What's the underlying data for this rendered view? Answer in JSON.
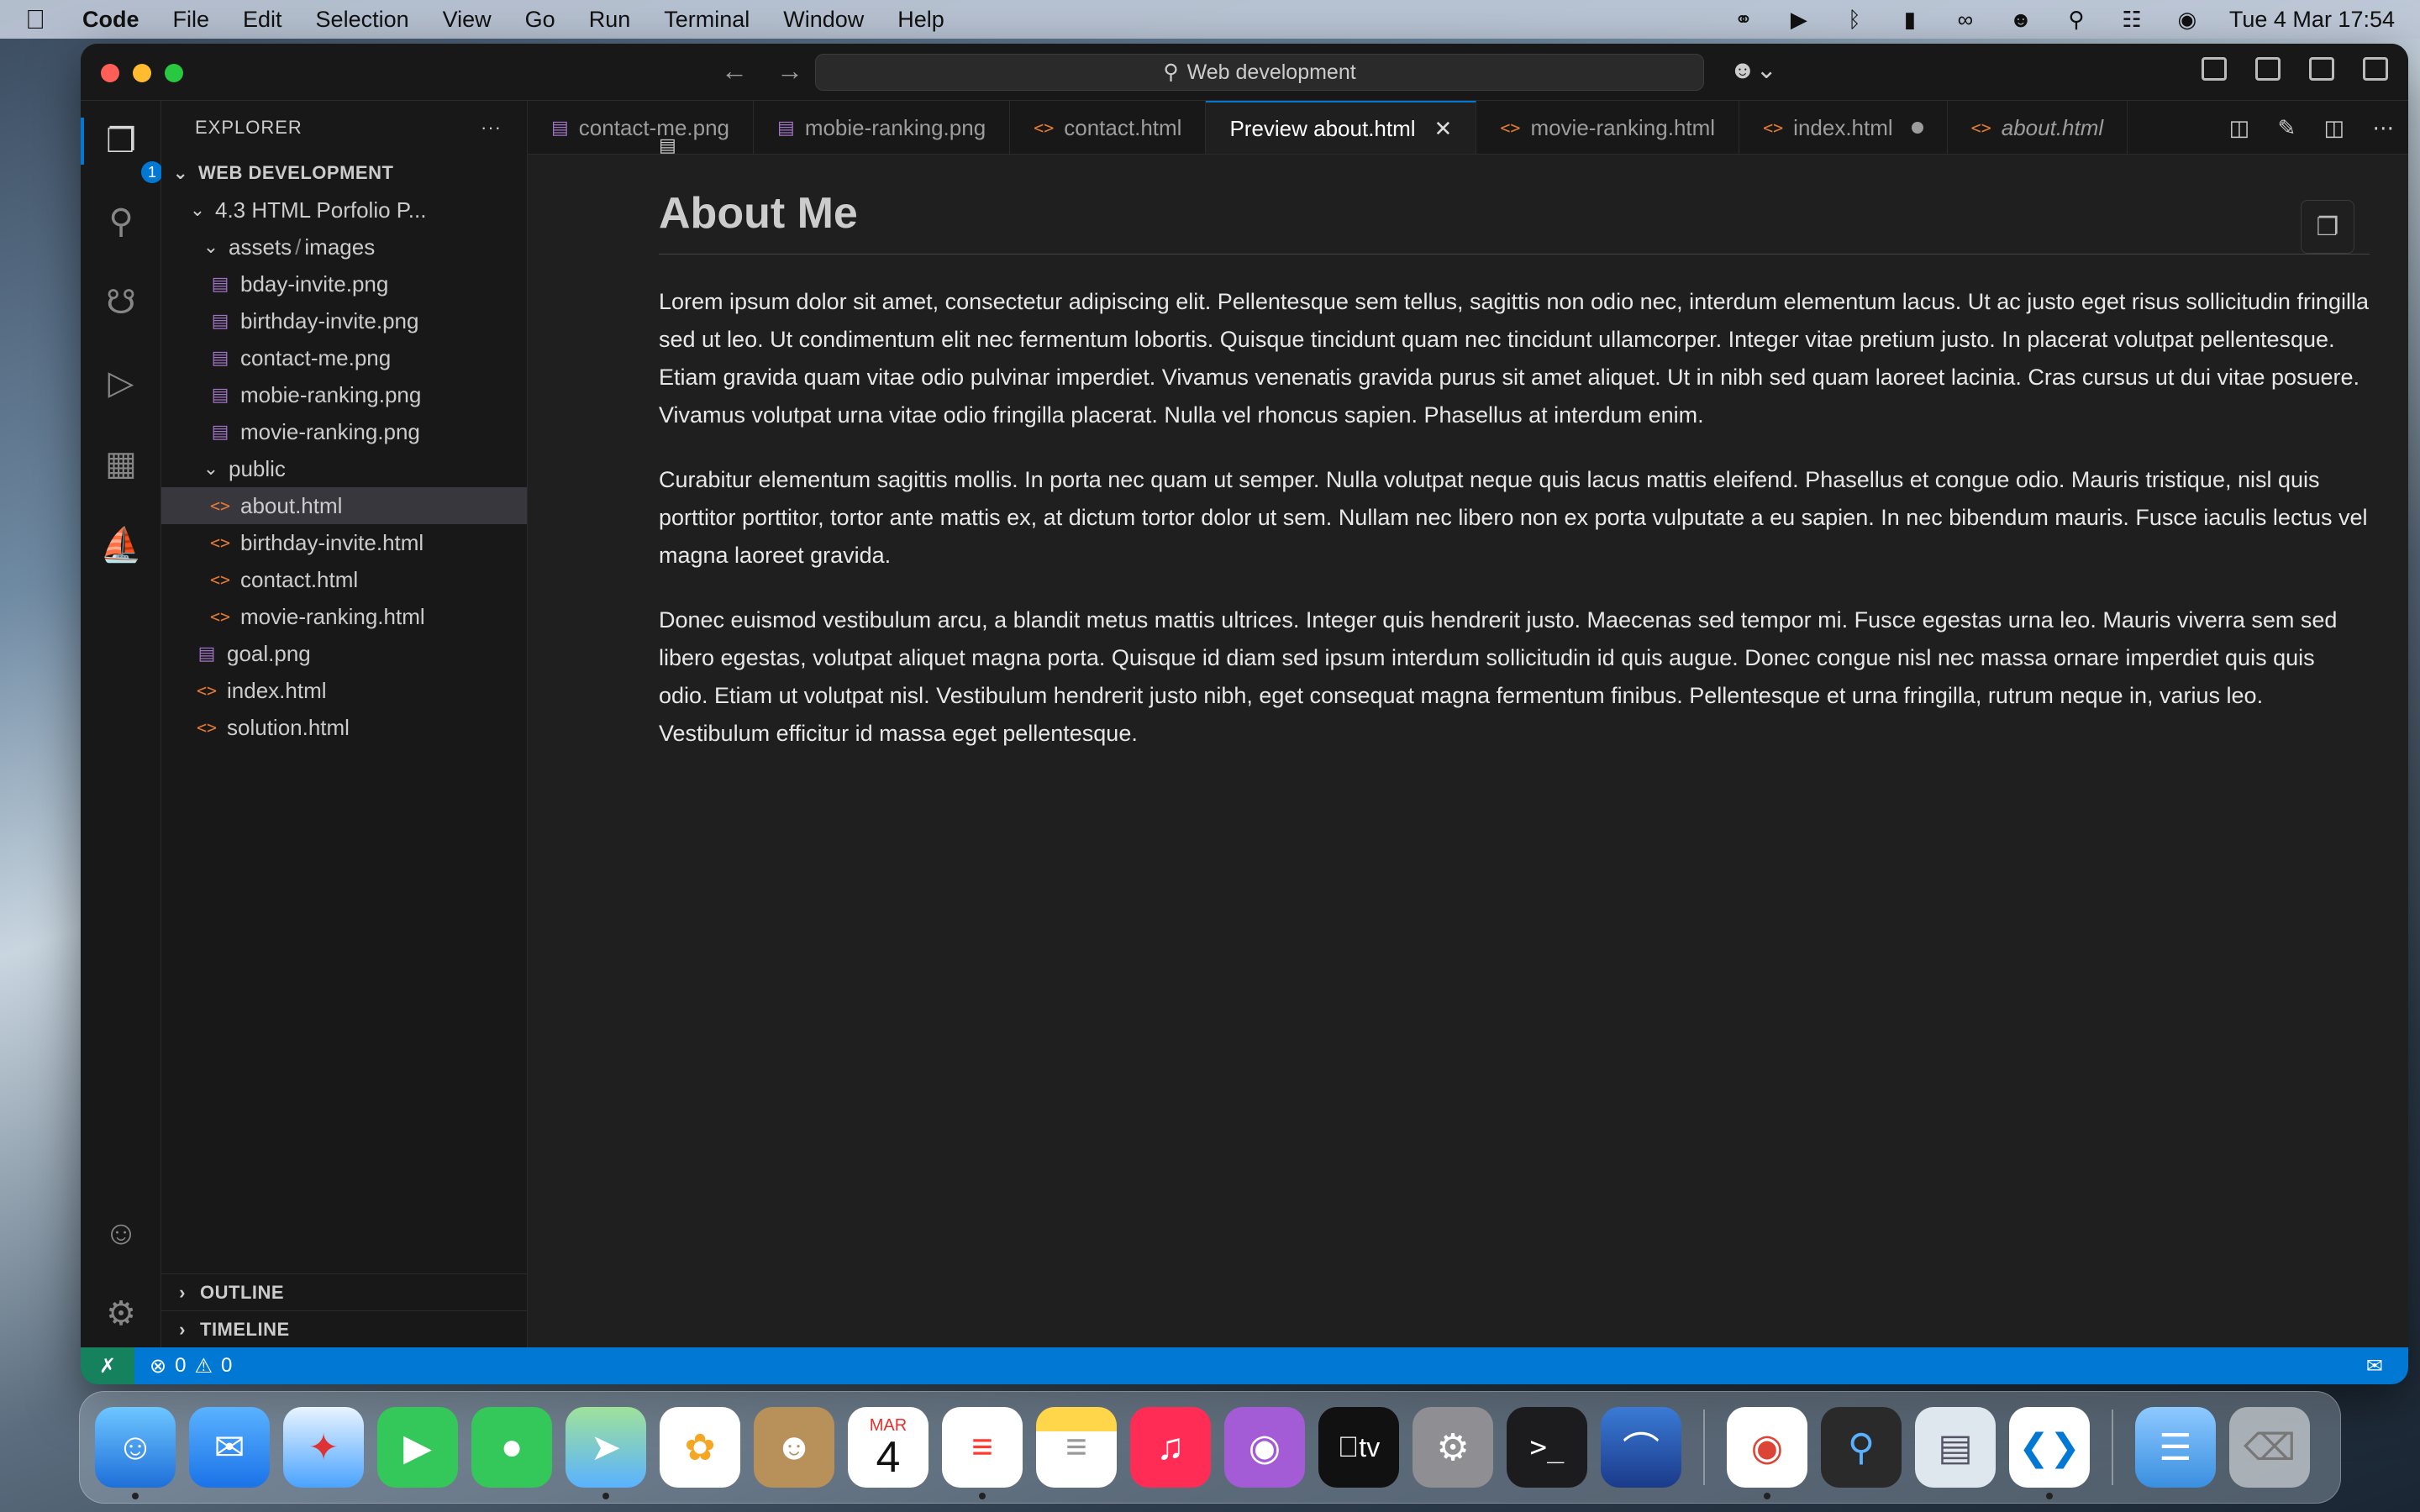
{
  "menubar": {
    "app": "Code",
    "items": [
      "File",
      "Edit",
      "Selection",
      "View",
      "Go",
      "Run",
      "Terminal",
      "Window",
      "Help"
    ],
    "clock": "Tue 4 Mar  17:54"
  },
  "titlebar": {
    "search": "Web development"
  },
  "activity": {
    "explorer_badge": "1"
  },
  "sidebar": {
    "title": "EXPLORER",
    "more": "···",
    "workspace": "WEB DEVELOPMENT",
    "folder": "4.3 HTML Porfolio P...",
    "assets_folder": "assets",
    "assets_sep": "/",
    "images_folder": "images",
    "images": [
      "bday-invite.png",
      "birthday-invite.png",
      "contact-me.png",
      "mobie-ranking.png",
      "movie-ranking.png"
    ],
    "public_folder": "public",
    "public_files": [
      "about.html",
      "birthday-invite.html",
      "contact.html",
      "movie-ranking.html"
    ],
    "root_files": [
      {
        "name": "goal.png",
        "type": "png"
      },
      {
        "name": "index.html",
        "type": "html"
      },
      {
        "name": "solution.html",
        "type": "html"
      }
    ],
    "outline": "OUTLINE",
    "timeline": "TIMELINE"
  },
  "tabs": [
    {
      "label": "contact-me.png",
      "type": "png"
    },
    {
      "label": "mobie-ranking.png",
      "type": "png"
    },
    {
      "label": "contact.html",
      "type": "html"
    },
    {
      "label": "Preview about.html",
      "type": "preview",
      "active": true
    },
    {
      "label": "movie-ranking.html",
      "type": "html"
    },
    {
      "label": "index.html",
      "type": "html",
      "dirty": true
    },
    {
      "label": "about.html",
      "type": "html",
      "italic": true
    }
  ],
  "preview": {
    "heading": "About Me",
    "paragraphs": [
      "Lorem ipsum dolor sit amet, consectetur adipiscing elit. Pellentesque sem tellus, sagittis non odio nec, interdum elementum lacus. Ut ac justo eget risus sollicitudin fringilla sed ut leo. Ut condimentum elit nec fermentum lobortis. Quisque tincidunt quam nec tincidunt ullamcorper. Integer vitae pretium justo. In placerat volutpat pellentesque. Etiam gravida quam vitae odio pulvinar imperdiet. Vivamus venenatis gravida purus sit amet aliquet. Ut in nibh sed quam laoreet lacinia. Cras cursus ut dui vitae posuere. Vivamus volutpat urna vitae odio fringilla placerat. Nulla vel rhoncus sapien. Phasellus at interdum enim.",
      "Curabitur elementum sagittis mollis. In porta nec quam ut semper. Nulla volutpat neque quis lacus mattis eleifend. Phasellus et congue odio. Mauris tristique, nisl quis porttitor porttitor, tortor ante mattis ex, at dictum tortor dolor ut sem. Nullam nec libero non ex porta vulputate a eu sapien. In nec bibendum mauris. Fusce iaculis lectus vel magna laoreet gravida.",
      "Donec euismod vestibulum arcu, a blandit metus mattis ultrices. Integer quis hendrerit justo. Maecenas sed tempor mi. Fusce egestas urna leo. Mauris viverra sem sed libero egestas, volutpat aliquet magna porta. Quisque id diam sed ipsum interdum sollicitudin id quis augue. Donec congue nisl nec massa ornare imperdiet quis quis odio. Etiam ut volutpat nisl. Vestibulum hendrerit justo nibh, eget consequat magna fermentum finibus. Pellentesque et urna fringilla, rutrum neque in, varius leo. Vestibulum efficitur id massa eget pellentesque."
    ]
  },
  "statusbar": {
    "errors": "0",
    "warnings": "0"
  },
  "dock": {
    "calendar_month": "MAR",
    "calendar_day": "4",
    "tv_label": "tv"
  },
  "colors": {
    "accent": "#0078d4",
    "html_icon": "#e37933",
    "png_icon": "#a074c4"
  }
}
